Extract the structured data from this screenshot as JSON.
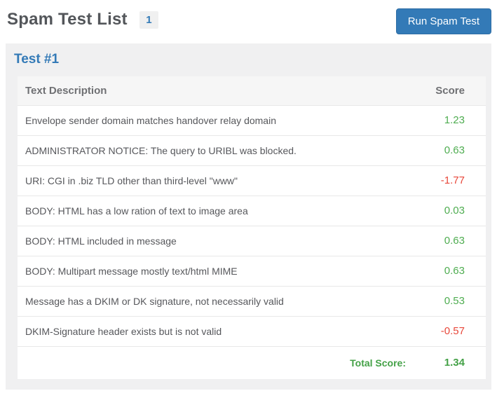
{
  "header": {
    "title": "Spam Test List",
    "count_badge": "1",
    "run_button_label": "Run Spam Test"
  },
  "panel": {
    "heading": "Test #1"
  },
  "table": {
    "columns": {
      "description": "Text Description",
      "score": "Score"
    },
    "rows": [
      {
        "description": "Envelope sender domain matches handover relay domain",
        "score": "1.23"
      },
      {
        "description": "ADMINISTRATOR NOTICE: The query to URIBL was blocked.",
        "score": "0.63"
      },
      {
        "description": "URI: CGI in .biz TLD other than third-level \"www\"",
        "score": "-1.77"
      },
      {
        "description": "BODY: HTML has a low ration of text to image area",
        "score": "0.03"
      },
      {
        "description": "BODY: HTML included in message",
        "score": "0.63"
      },
      {
        "description": "BODY: Multipart message mostly text/html MIME",
        "score": "0.63"
      },
      {
        "description": "Message has a DKIM or DK signature, not necessarily valid",
        "score": "0.53"
      },
      {
        "description": "DKIM-Signature header exists but is not valid",
        "score": "-0.57"
      }
    ],
    "total": {
      "label": "Total Score:",
      "value": "1.34"
    }
  },
  "colors": {
    "accent_blue": "#337ab7",
    "score_positive": "#4fad51",
    "score_negative": "#e8483b",
    "total_green": "#44a147"
  }
}
